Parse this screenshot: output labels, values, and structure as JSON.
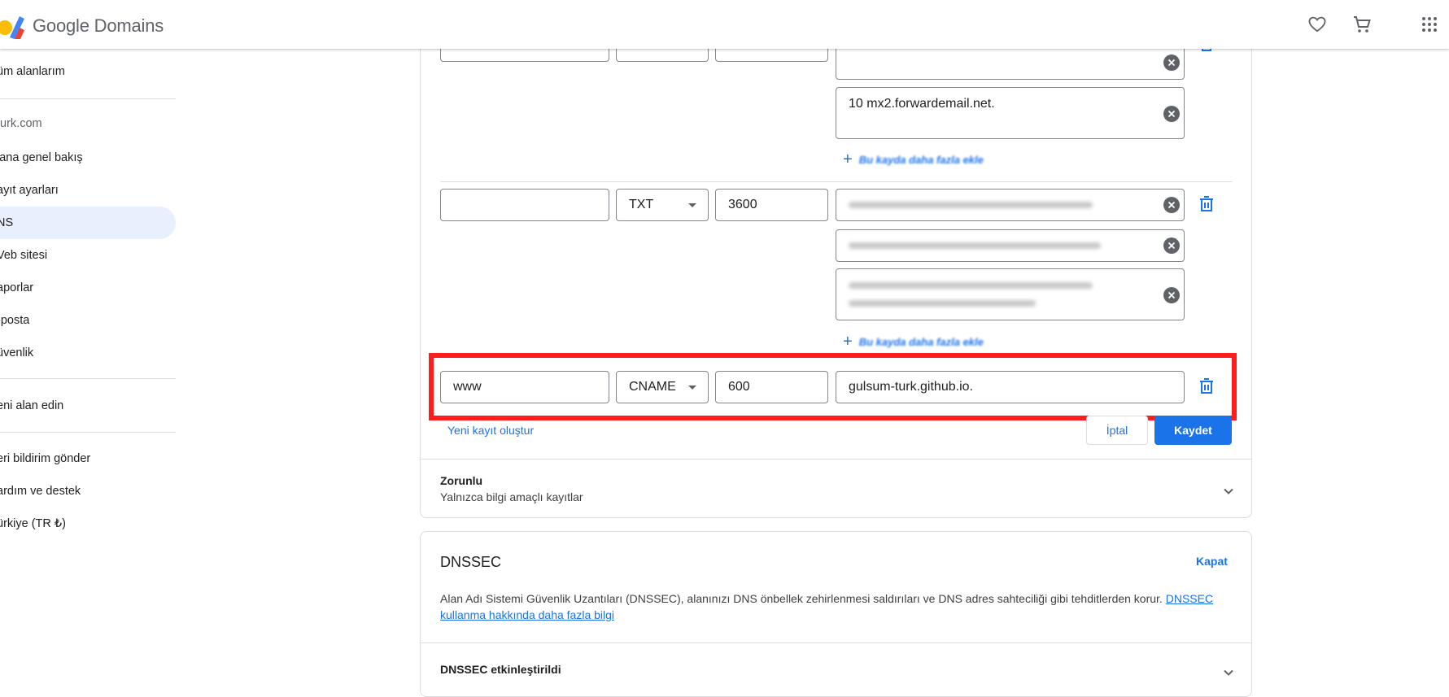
{
  "header": {
    "brand": "Google Domains",
    "icons": [
      "heart-icon",
      "cart-icon",
      "apps-grid-icon"
    ]
  },
  "sidebar": {
    "all_domains": "üm alanlarım",
    "domain": "turk.com",
    "items": [
      {
        "label": "lana genel bakış"
      },
      {
        "label": "ayıt ayarları"
      },
      {
        "label": "NS"
      },
      {
        "label": "Veb sitesi"
      },
      {
        "label": "aporlar"
      },
      {
        "label": "-posta"
      },
      {
        "label": "üvenlik"
      }
    ],
    "new_domain": "eni alan edin",
    "footer": [
      {
        "label": "eri bildirim gönder"
      },
      {
        "label": "ardım ve destek"
      },
      {
        "label": "ürkiye (TR ₺)"
      }
    ]
  },
  "records": {
    "mx": {
      "value2": "10 mx2.forwardemail.net.",
      "add_more": "Bu kayda daha fazla ekle"
    },
    "txt": {
      "host": "",
      "type": "TXT",
      "ttl": "3600",
      "add_more": "Bu kayda daha fazla ekle"
    },
    "cname": {
      "host": "www",
      "type": "CNAME",
      "ttl": "600",
      "data": "gulsum-turk.github.io."
    }
  },
  "actions": {
    "new_record": "Yeni kayıt oluştur",
    "cancel": "İptal",
    "save": "Kaydet"
  },
  "required": {
    "title": "Zorunlu",
    "subtitle": "Yalnızca bilgi amaçlı kayıtlar"
  },
  "dnssec": {
    "title": "DNSSEC",
    "close": "Kapat",
    "description": "Alan Adı Sistemi Güvenlik Uzantıları (DNSSEC), alanınızı DNS önbellek zehirlenmesi saldırıları ve DNS adres sahteciliği gibi tehditlerden korur. ",
    "link_part1": "DNSSEC",
    "link_part2": "kullanma hakkında daha fazla bilgi",
    "status": "DNSSEC etkinleştirildi"
  },
  "colors": {
    "accent": "#1a73e8",
    "highlight": "#ff1c1c",
    "active_nav": "#e8f0fe"
  }
}
